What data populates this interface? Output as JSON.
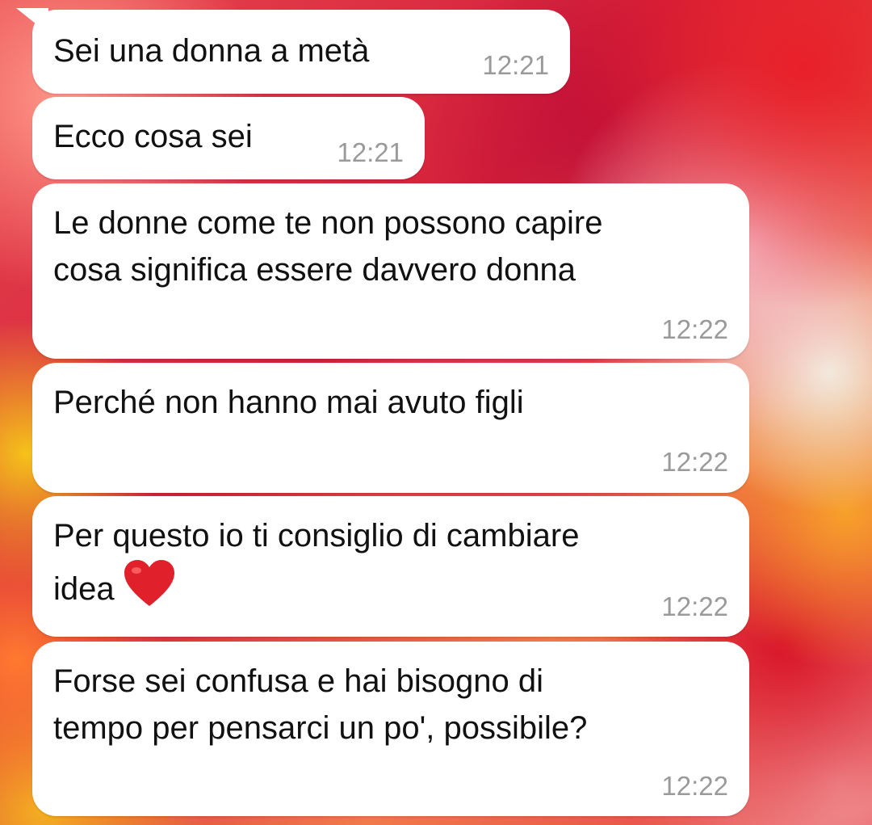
{
  "messages": [
    {
      "text": "Sei una donna a metà",
      "time": "12:21"
    },
    {
      "text": "Ecco cosa sei",
      "time": "12:21"
    },
    {
      "text": "Le donne come te non possono capire\ncosa significa essere davvero donna",
      "time": "12:22"
    },
    {
      "text": "Perché non hanno mai avuto figli",
      "time": "12:22"
    },
    {
      "text": "Per questo io ti consiglio di cambiare\nidea",
      "emoji": "red-heart-icon",
      "time": "12:22"
    },
    {
      "text": "Forse sei confusa e hai bisogno di\ntempo per pensarci un po', possibile?",
      "time": "12:22"
    }
  ],
  "colors": {
    "bubble": "#ffffff",
    "text": "#111111",
    "timestamp": "#9a9a9a",
    "heart": "#e0202a"
  }
}
